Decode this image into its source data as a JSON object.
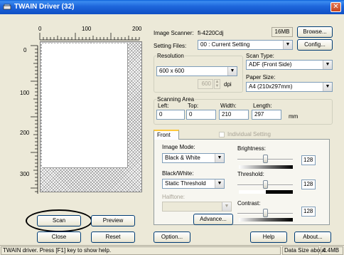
{
  "window": {
    "title": "TWAIN Driver (32)",
    "close_symbol": "✕"
  },
  "ruler": {
    "h_ticks": [
      "0",
      "100",
      "200"
    ],
    "v_ticks": [
      "0",
      "100",
      "200",
      "300"
    ]
  },
  "scanner": {
    "label": "Image Scanner:",
    "value": "fi-4220Cdj",
    "memory": "16MB",
    "browse": "Browse..."
  },
  "setting_files": {
    "label": "Setting Files:",
    "value": "00 : Current Setting",
    "config": "Config..."
  },
  "resolution": {
    "label": "Resolution",
    "value": "600 x 600",
    "custom_value": "600",
    "unit": "dpi"
  },
  "scan_type": {
    "label": "Scan Type:",
    "value": "ADF (Front Side)"
  },
  "paper_size": {
    "label": "Paper Size:",
    "value": "A4 (210x297mm)"
  },
  "scanning_area": {
    "label": "Scanning Area",
    "left_label": "Left:",
    "left": "0",
    "top_label": "Top:",
    "top": "0",
    "width_label": "Width:",
    "width": "210",
    "length_label": "Length:",
    "length": "297",
    "unit": "mm"
  },
  "tabs": {
    "front": "Front",
    "individual_setting": "Individual Setting"
  },
  "image_mode": {
    "label": "Image Mode:",
    "value": "Black & White"
  },
  "black_white": {
    "label": "Black/White:",
    "value": "Static Threshold"
  },
  "halftone": {
    "label": "Halftone:",
    "value": ""
  },
  "advance": "Advance...",
  "brightness": {
    "label": "Brightness:",
    "value": "128",
    "level": 0.5
  },
  "threshold": {
    "label": "Threshold:",
    "value": "128",
    "level": 0.5
  },
  "contrast": {
    "label": "Contrast:",
    "value": "128",
    "level": 0.5
  },
  "buttons": {
    "scan": "Scan",
    "preview": "Preview",
    "close": "Close",
    "reset": "Reset",
    "option": "Option...",
    "help": "Help",
    "about": "About..."
  },
  "status": {
    "hint": "TWAIN driver. Press [F1] key to show help.",
    "data_size_label": "Data Size about:",
    "data_size_value": "4.4MB"
  },
  "colors": {
    "title_blue": "#0f4fc4",
    "face": "#ece9d8",
    "highlight_circle": "#000000"
  }
}
